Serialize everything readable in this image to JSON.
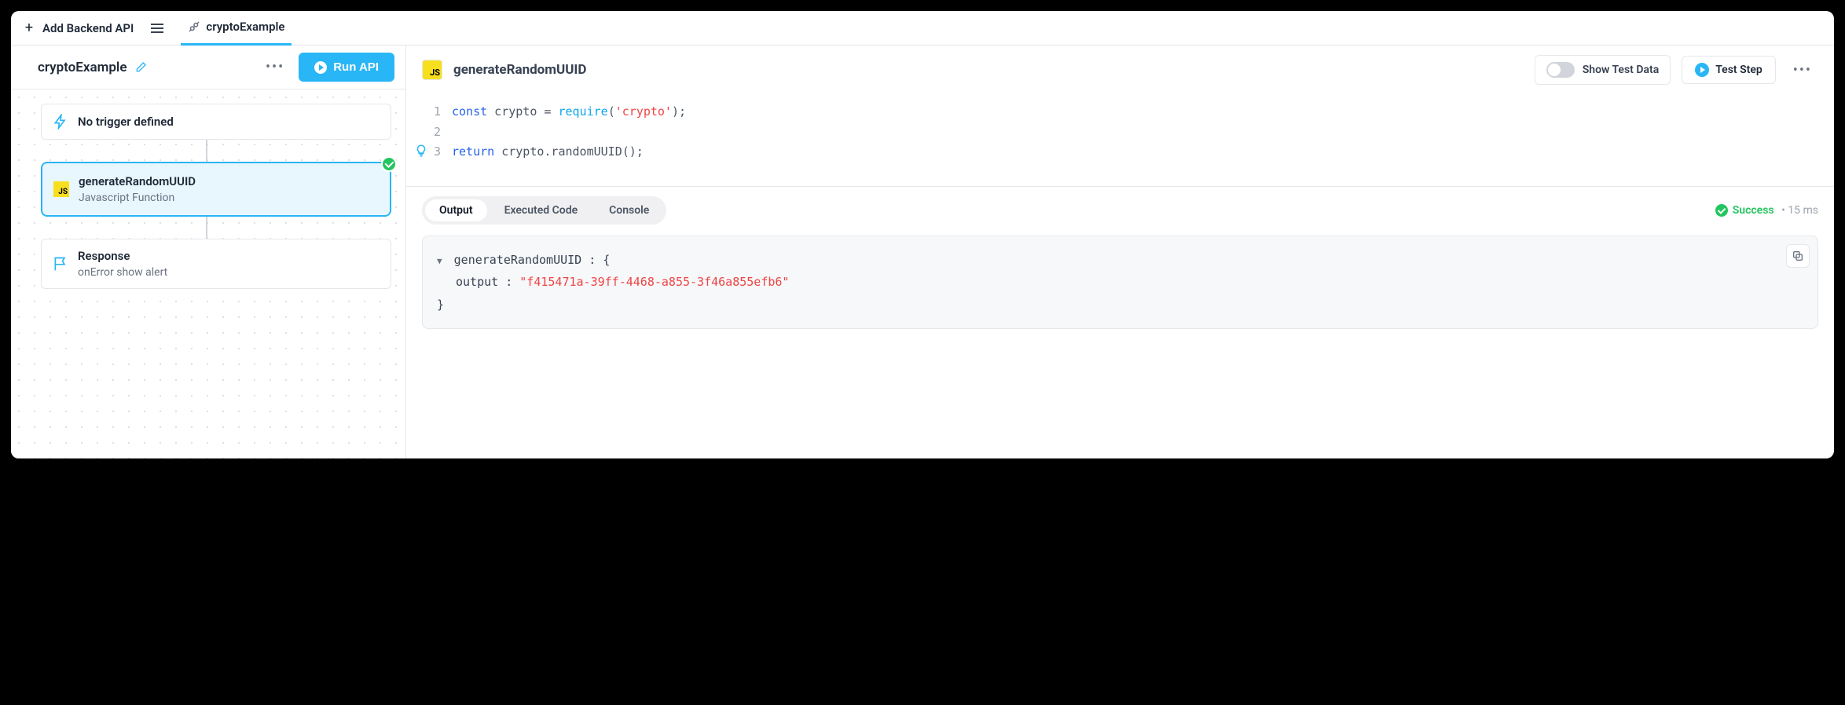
{
  "topbar": {
    "add_api_label": "Add Backend API",
    "tab_label": "cryptoExample"
  },
  "sidebar": {
    "api_name": "cryptoExample",
    "run_label": "Run API",
    "trigger": {
      "title": "No trigger defined"
    },
    "step": {
      "title": "generateRandomUUID",
      "subtitle": "Javascript Function"
    },
    "response": {
      "title": "Response",
      "subtitle": "onError show alert"
    }
  },
  "content": {
    "step_title": "generateRandomUUID",
    "show_test_data": "Show Test Data",
    "test_step": "Test Step",
    "code": {
      "line1": {
        "kw1": "const",
        "mid": " crypto = ",
        "fn": "require",
        "paren1": "(",
        "str": "'crypto'",
        "paren2": ");"
      },
      "line2": "",
      "line3": {
        "kw1": "return",
        "rest": " crypto.randomUUID();"
      }
    },
    "tabs": {
      "output": "Output",
      "executed": "Executed Code",
      "console": "Console"
    },
    "status_label": "Success",
    "timing": "15 ms",
    "output": {
      "name": "generateRandomUUID",
      "key": "output",
      "value": "\"f415471a-39ff-4468-a855-3f46a855efb6\""
    }
  }
}
